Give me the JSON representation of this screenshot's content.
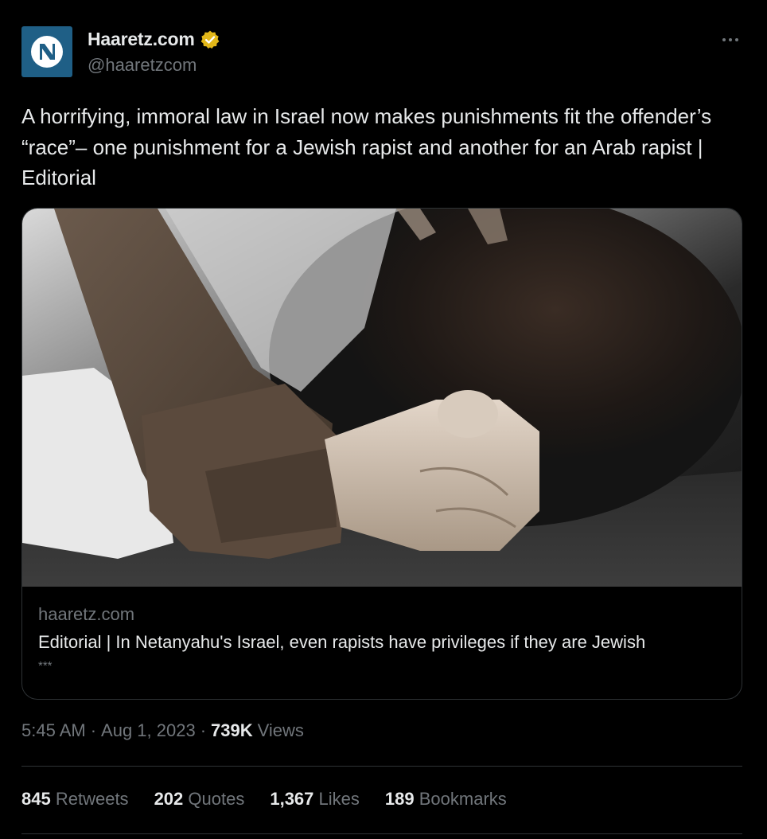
{
  "author": {
    "display_name": "Haaretz.com",
    "handle": "@haaretzcom",
    "verified_color": "#e2b719",
    "avatar_icon": "haaretz-logo-icon",
    "avatar_bg": "#1f5f86"
  },
  "more_icon": "more-horizontal-icon",
  "tweet": {
    "text": "A horrifying, immoral law in Israel now makes punishments fit the offender’s “race”– one punishment for a Jewish rapist and another for an Arab rapist | Editorial"
  },
  "card": {
    "domain": "haaretz.com",
    "title": "Editorial | In Netanyahu's Israel, even rapists have privileges if they are Jewish",
    "description": "***"
  },
  "meta": {
    "time": "5:45 AM",
    "date": "Aug 1, 2023",
    "views_count": "739K",
    "views_label": "Views",
    "separator": "·"
  },
  "stats": [
    {
      "count": "845",
      "label": "Retweets"
    },
    {
      "count": "202",
      "label": "Quotes"
    },
    {
      "count": "1,367",
      "label": "Likes"
    },
    {
      "count": "189",
      "label": "Bookmarks"
    }
  ],
  "colors": {
    "background": "#000000",
    "text_primary": "#e7e9ea",
    "text_secondary": "#71767b",
    "border": "#2f3336"
  }
}
